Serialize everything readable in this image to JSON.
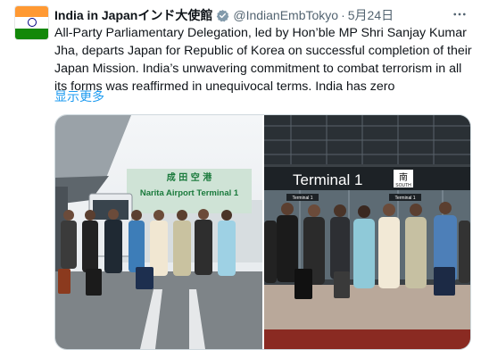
{
  "tweet": {
    "author_name": "India in Japanインド大使館",
    "handle": "@IndianEmbTokyo",
    "separator": "·",
    "date": "5月24日",
    "more_icon": "more-horizontal-icon",
    "text": "All-Party Parliamentary Delegation, led by Hon’ble MP Shri Sanjay Kumar Jha, departs Japan for Republic of Korea on successful completion of their Japan Mission. India’s unwavering commitment to combat terrorism in all its forms was reaffirmed in unequivocal terms. India has zero",
    "show_more": "显示更多",
    "verified_icon": "verified-badge-icon",
    "colors": {
      "verified": "#829aab",
      "link": "#1d9bf0",
      "secondary": "#536471"
    }
  },
  "media": {
    "left_photo": {
      "sign_kanji": "成 田 空 港",
      "sign_text": "Narita Airport Terminal 1"
    },
    "right_photo": {
      "sign_text": "Terminal 1",
      "kanji": "南",
      "kanji_sub": "SOUTH",
      "small_sign": "Terminal 1"
    }
  }
}
